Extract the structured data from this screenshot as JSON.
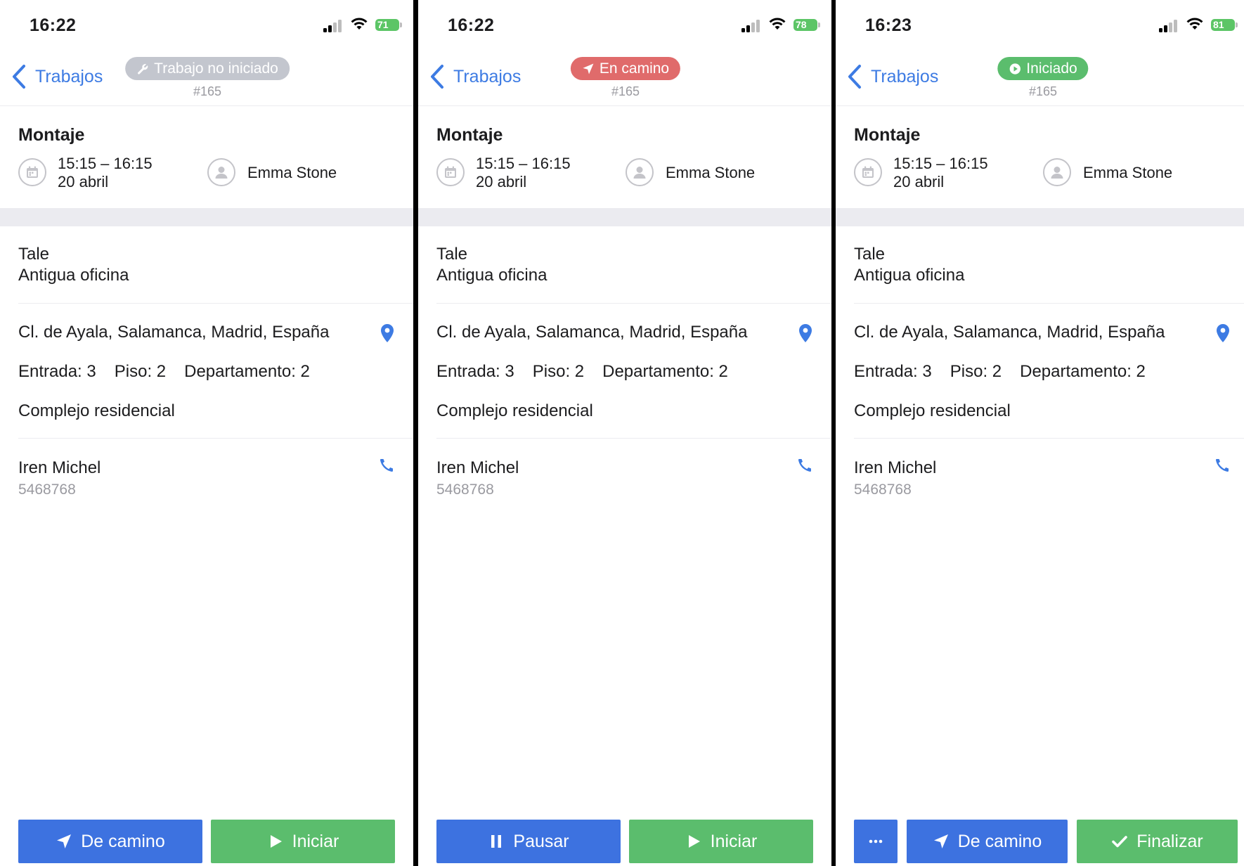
{
  "colors": {
    "accent": "#3d7be3",
    "blue_button": "#3d72e0",
    "green_button": "#5bbd6d",
    "pill_gray": "#c3c6ce",
    "pill_red": "#e06b6b",
    "pill_green": "#5bbd6d"
  },
  "screens": [
    {
      "clock": "16:22",
      "battery": "71",
      "back_label": "Trabajos",
      "status_label": "Trabajo no iniciado",
      "status_icon": "wrench-icon",
      "job_number": "#165",
      "job_title": "Montaje",
      "time_range": "15:15 – 16:15",
      "date": "20 abril",
      "worker": "Emma Stone",
      "client": "Tale",
      "site": "Antigua oficina",
      "address": "Cl. de Ayala, Salamanca, Madrid, España",
      "entrance": "Entrada: 3",
      "floor": "Piso: 2",
      "apartment": "Departamento: 2",
      "place_type": "Complejo residencial",
      "contact_name": "Iren Michel",
      "contact_phone": "5468768",
      "buttons": [
        {
          "label": "De camino",
          "icon": "navigation-arrow-icon",
          "color": "blue"
        },
        {
          "label": "Iniciar",
          "icon": "play-icon",
          "color": "green"
        }
      ]
    },
    {
      "clock": "16:22",
      "battery": "78",
      "back_label": "Trabajos",
      "status_label": "En camino",
      "status_icon": "navigation-arrow-icon",
      "job_number": "#165",
      "job_title": "Montaje",
      "time_range": "15:15 – 16:15",
      "date": "20 abril",
      "worker": "Emma Stone",
      "client": "Tale",
      "site": "Antigua oficina",
      "address": "Cl. de Ayala, Salamanca, Madrid, España",
      "entrance": "Entrada: 3",
      "floor": "Piso: 2",
      "apartment": "Departamento: 2",
      "place_type": "Complejo residencial",
      "contact_name": "Iren Michel",
      "contact_phone": "5468768",
      "buttons": [
        {
          "label": "Pausar",
          "icon": "pause-icon",
          "color": "blue"
        },
        {
          "label": "Iniciar",
          "icon": "play-icon",
          "color": "green"
        }
      ]
    },
    {
      "clock": "16:23",
      "battery": "81",
      "back_label": "Trabajos",
      "status_label": "Iniciado",
      "status_icon": "play-circle-icon",
      "job_number": "#165",
      "job_title": "Montaje",
      "time_range": "15:15 – 16:15",
      "date": "20 abril",
      "worker": "Emma Stone",
      "client": "Tale",
      "site": "Antigua oficina",
      "address": "Cl. de Ayala, Salamanca, Madrid, España",
      "entrance": "Entrada: 3",
      "floor": "Piso: 2",
      "apartment": "Departamento: 2",
      "place_type": "Complejo residencial",
      "contact_name": "Iren Michel",
      "contact_phone": "5468768",
      "buttons": [
        {
          "label": "De camino",
          "icon": "navigation-arrow-icon",
          "color": "blue"
        },
        {
          "label": "Finalizar",
          "icon": "checkmark-icon",
          "color": "green"
        }
      ],
      "more_button": "more-icon"
    }
  ]
}
